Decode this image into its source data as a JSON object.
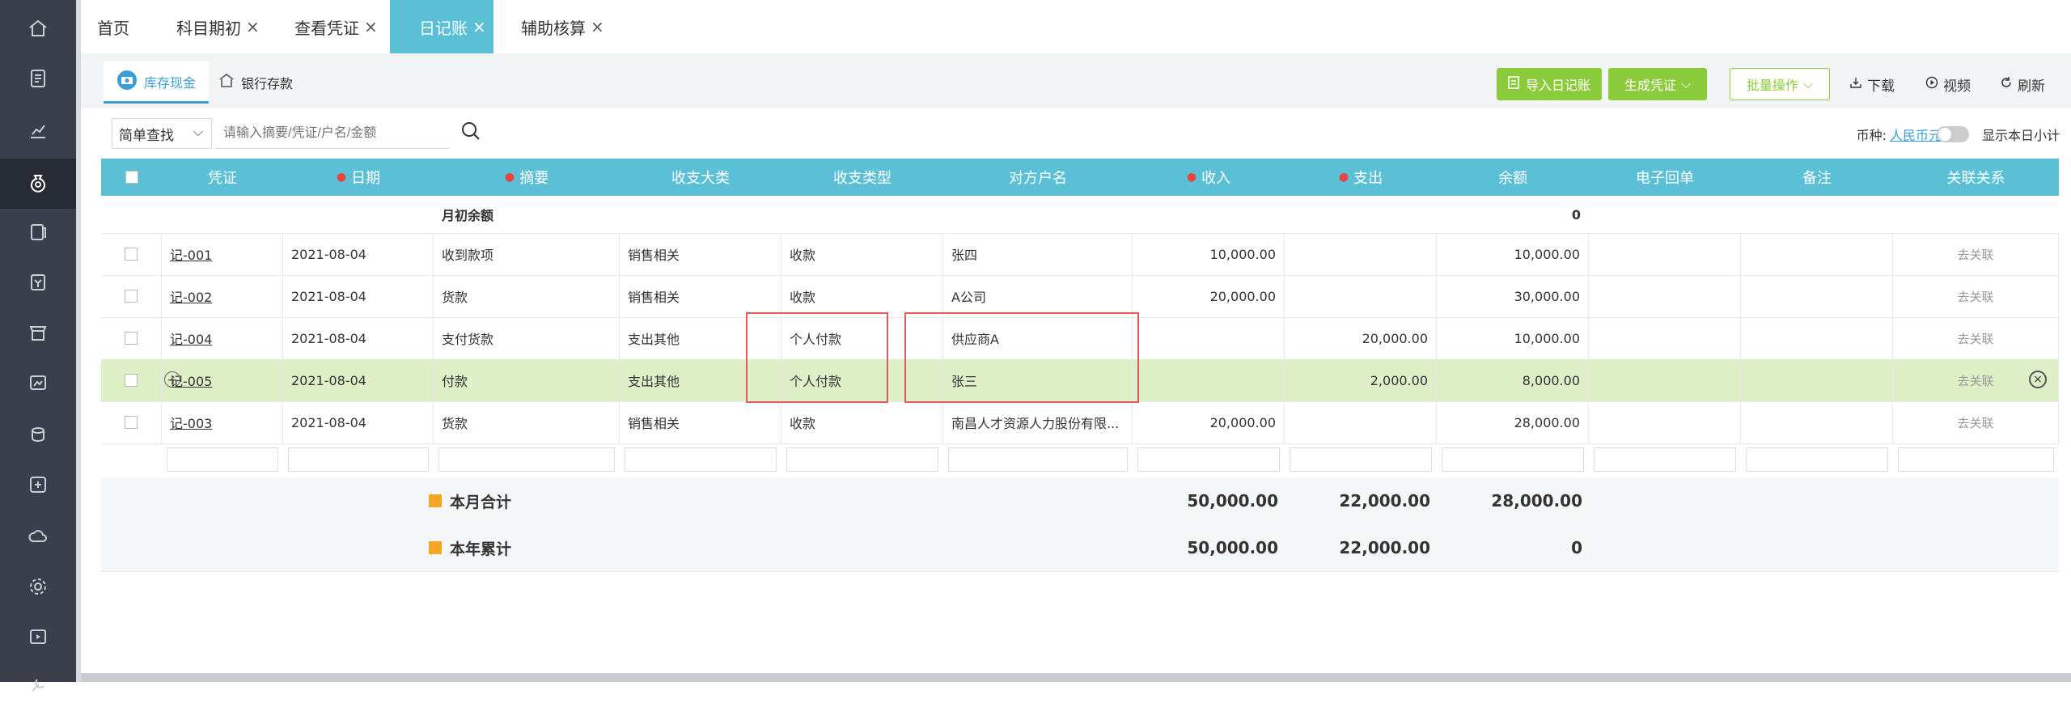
{
  "sidebar": {
    "icons": [
      "home-icon",
      "report-icon",
      "chart-icon",
      "money-bag-icon",
      "ledger-icon",
      "invoice-icon",
      "store-icon",
      "asset-icon",
      "coins-icon",
      "voucher-icon",
      "cloud-icon",
      "settings-icon",
      "media-icon",
      "tools-icon"
    ],
    "active_index": 3
  },
  "tabs": [
    {
      "label": "首页",
      "closable": false
    },
    {
      "label": "科目期初",
      "closable": true
    },
    {
      "label": "查看凭证",
      "closable": true
    },
    {
      "label": "日记账",
      "closable": true,
      "active": true
    },
    {
      "label": "辅助核算",
      "closable": true
    }
  ],
  "tab_close_glyph": "×",
  "subtabs": [
    {
      "label": "库存现金",
      "active": true
    },
    {
      "label": "银行存款",
      "active": false
    }
  ],
  "toolbar": {
    "import_label": "导入日记账",
    "generate_label": "生成凭证",
    "batch_label": "批量操作",
    "download_label": "下载",
    "video_label": "视频",
    "refresh_label": "刷新"
  },
  "filter": {
    "mode": "简单查找",
    "search_placeholder": "请输入摘要/凭证/户名/金额",
    "currency_label": "币种:",
    "currency_value": "人民币元",
    "toggle_label": "显示本日小计"
  },
  "table": {
    "headers": [
      "凭证",
      "日期",
      "摘要",
      "收支大类",
      "收支类型",
      "对方户名",
      "收入",
      "支出",
      "余额",
      "电子回单",
      "备注",
      "关联关系"
    ],
    "required": [
      "日期",
      "摘要",
      "收入",
      "支出"
    ],
    "opening": {
      "label": "月初余额",
      "balance": "0"
    },
    "rows": [
      {
        "voucher": "记-001",
        "date": "2021-08-04",
        "summary": "收到款项",
        "category": "销售相关",
        "type": "收款",
        "party": "张四",
        "income": "10,000.00",
        "expense": "",
        "balance": "10,000.00",
        "link": "去关联"
      },
      {
        "voucher": "记-002",
        "date": "2021-08-04",
        "summary": "货款",
        "category": "销售相关",
        "type": "收款",
        "party": "A公司",
        "income": "20,000.00",
        "expense": "",
        "balance": "30,000.00",
        "link": "去关联"
      },
      {
        "voucher": "记-004",
        "date": "2021-08-04",
        "summary": "支付货款",
        "category": "支出其他",
        "type": "个人付款",
        "party": "供应商A",
        "income": "",
        "expense": "20,000.00",
        "balance": "10,000.00",
        "link": "去关联"
      },
      {
        "voucher": "记-005",
        "date": "2021-08-04",
        "summary": "付款",
        "category": "支出其他",
        "type": "个人付款",
        "party": "张三",
        "income": "",
        "expense": "2,000.00",
        "balance": "8,000.00",
        "link": "去关联",
        "highlight": true
      },
      {
        "voucher": "记-003",
        "date": "2021-08-04",
        "summary": "货款",
        "category": "销售相关",
        "type": "收款",
        "party": "南昌人才资源人力股份有限...",
        "income": "20,000.00",
        "expense": "",
        "balance": "28,000.00",
        "link": "去关联"
      }
    ],
    "month_total": {
      "label": "本月合计",
      "income": "50,000.00",
      "expense": "22,000.00",
      "balance": "28,000.00"
    },
    "year_total": {
      "label": "本年累计",
      "income": "50,000.00",
      "expense": "22,000.00",
      "balance": "0"
    }
  },
  "colors": {
    "accent": "#5bc0d6",
    "green": "#8ccb3b",
    "highlight": "#dff0c8",
    "annotation": "#e05b5b"
  }
}
